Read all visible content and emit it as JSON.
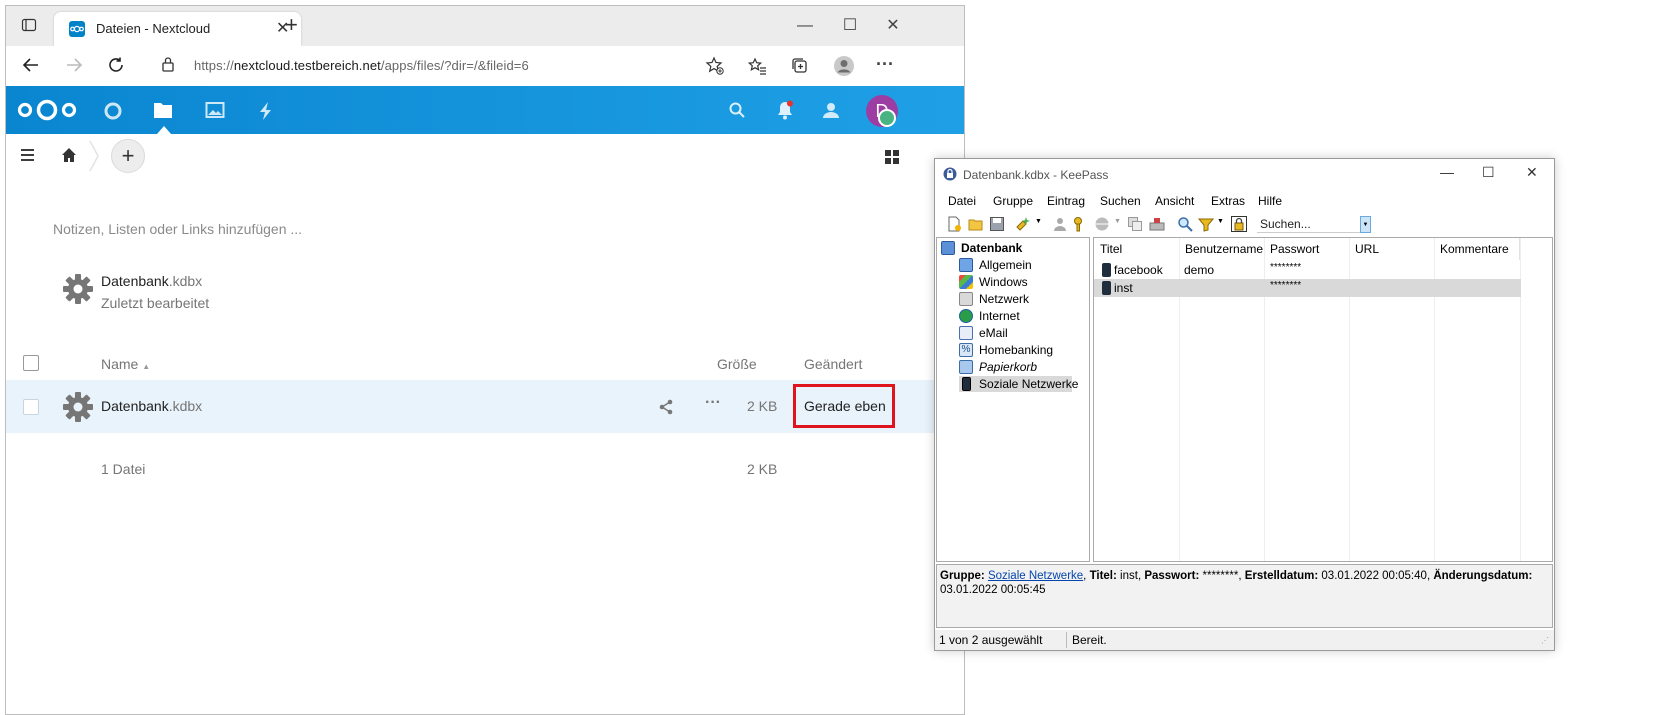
{
  "browser": {
    "tab_title": "Dateien - Nextcloud",
    "url_prefix": "https://",
    "url_domain": "nextcloud.testbereich.net",
    "url_path": "/apps/files/?dir=/&fileid=6"
  },
  "nextcloud": {
    "avatar_initial": "D",
    "notes_placeholder": "Notizen, Listen oder Links hinzufügen ...",
    "recent": {
      "name": "Datenbank",
      "ext": ".kdbx",
      "subtitle": "Zuletzt bearbeitet"
    },
    "columns": {
      "name": "Name",
      "size": "Größe",
      "modified": "Geändert"
    },
    "file_row": {
      "name": "Datenbank",
      "ext": ".kdbx",
      "size": "2 KB",
      "modified": "Gerade eben"
    },
    "summary": {
      "count": "1 Datei",
      "size": "2 KB"
    }
  },
  "keepass": {
    "window_title": "Datenbank.kdbx - KeePass",
    "menu": [
      "Datei",
      "Gruppe",
      "Eintrag",
      "Suchen",
      "Ansicht",
      "Extras",
      "Hilfe"
    ],
    "search_placeholder": "Suchen...",
    "tree": {
      "root": "Datenbank",
      "groups": [
        "Allgemein",
        "Windows",
        "Netzwerk",
        "Internet",
        "eMail",
        "Homebanking",
        "Papierkorb",
        "Soziale Netzwerke"
      ],
      "selected": "Soziale Netzwerke"
    },
    "columns": [
      "Titel",
      "Benutzername",
      "Passwort",
      "URL",
      "Kommentare"
    ],
    "entries": [
      {
        "title": "facebook",
        "user": "demo",
        "password": "********",
        "url": "",
        "comment": ""
      },
      {
        "title": "inst",
        "user": "",
        "password": "********",
        "url": "",
        "comment": ""
      }
    ],
    "info": {
      "group_label": "Gruppe:",
      "group_value": "Soziale Netzwerke",
      "title_label": "Titel:",
      "title_value": "inst",
      "password_label": "Passwort:",
      "password_value": "********",
      "created_label": "Erstelldatum:",
      "created_value": "03.01.2022 00:05:40",
      "modified_label": "Änderungsdatum:",
      "modified_value": "03.01.2022 00:05:45"
    },
    "status": {
      "selection": "1 von 2 ausgewählt",
      "state": "Bereit."
    }
  },
  "colors": {
    "nextcloud_blue": "#0082c9",
    "highlight_red": "#e0141e",
    "selected_row": "#e9f3fb"
  }
}
